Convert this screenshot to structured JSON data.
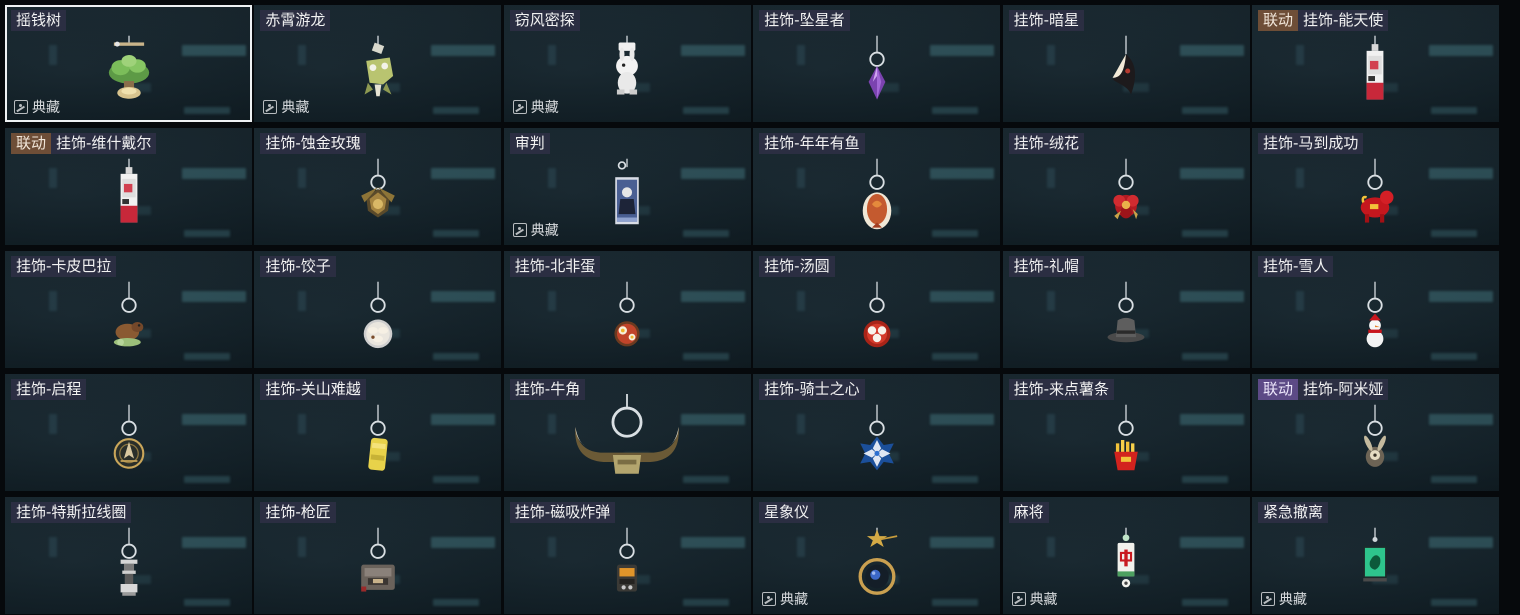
{
  "badges": {
    "linked": "联动",
    "collection": "典藏"
  },
  "items": [
    {
      "name": "摇钱树",
      "linked": false,
      "collection": true,
      "selected": true,
      "art": "money-tree"
    },
    {
      "name": "赤霄游龙",
      "linked": false,
      "collection": true,
      "selected": false,
      "art": "dragon"
    },
    {
      "name": "窃风密探",
      "linked": false,
      "collection": true,
      "selected": false,
      "art": "spy-rabbit"
    },
    {
      "name": "挂饰-坠星者",
      "linked": false,
      "collection": false,
      "selected": false,
      "art": "purple-crystal"
    },
    {
      "name": "挂饰-暗星",
      "linked": false,
      "collection": false,
      "selected": false,
      "art": "dark-star"
    },
    {
      "name": "挂饰-能天使",
      "linked": true,
      "linkTone": "brown",
      "collection": false,
      "selected": false,
      "art": "red-card"
    },
    {
      "name": "挂饰-维什戴尔",
      "linked": true,
      "linkTone": "brown",
      "collection": false,
      "selected": false,
      "art": "red-card"
    },
    {
      "name": "挂饰-蚀金玫瑰",
      "linked": false,
      "collection": false,
      "selected": false,
      "art": "gold-rose"
    },
    {
      "name": "审判",
      "linked": false,
      "collection": true,
      "selected": false,
      "art": "judgment-card"
    },
    {
      "name": "挂饰-年年有鱼",
      "linked": false,
      "collection": false,
      "selected": false,
      "art": "fish"
    },
    {
      "name": "挂饰-绒花",
      "linked": false,
      "collection": false,
      "selected": false,
      "art": "red-flower"
    },
    {
      "name": "挂饰-马到成功",
      "linked": false,
      "collection": false,
      "selected": false,
      "art": "red-horse"
    },
    {
      "name": "挂饰-卡皮巴拉",
      "linked": false,
      "collection": false,
      "selected": false,
      "art": "capybara"
    },
    {
      "name": "挂饰-饺子",
      "linked": false,
      "collection": false,
      "selected": false,
      "art": "dumplings"
    },
    {
      "name": "挂饰-北非蛋",
      "linked": false,
      "collection": false,
      "selected": false,
      "art": "shakshuka"
    },
    {
      "name": "挂饰-汤圆",
      "linked": false,
      "collection": false,
      "selected": false,
      "art": "tangyuan"
    },
    {
      "name": "挂饰-礼帽",
      "linked": false,
      "collection": false,
      "selected": false,
      "art": "top-hat"
    },
    {
      "name": "挂饰-雪人",
      "linked": false,
      "collection": false,
      "selected": false,
      "art": "snowman"
    },
    {
      "name": "挂饰-启程",
      "linked": false,
      "collection": false,
      "selected": false,
      "art": "compass-medal"
    },
    {
      "name": "挂饰-关山难越",
      "linked": false,
      "collection": false,
      "selected": false,
      "art": "yellow-block"
    },
    {
      "name": "挂饰-牛角",
      "linked": false,
      "collection": false,
      "selected": false,
      "art": "bull-horns"
    },
    {
      "name": "挂饰-骑士之心",
      "linked": false,
      "collection": false,
      "selected": false,
      "art": "blue-cross"
    },
    {
      "name": "挂饰-来点薯条",
      "linked": false,
      "collection": false,
      "selected": false,
      "art": "fries"
    },
    {
      "name": "挂饰-阿米娅",
      "linked": true,
      "linkTone": "violet",
      "collection": false,
      "selected": false,
      "art": "rabbit-charm"
    },
    {
      "name": "挂饰-特斯拉线圈",
      "linked": false,
      "collection": false,
      "selected": false,
      "art": "tesla-coil"
    },
    {
      "name": "挂饰-枪匠",
      "linked": false,
      "collection": false,
      "selected": false,
      "art": "gun-case"
    },
    {
      "name": "挂饰-磁吸炸弹",
      "linked": false,
      "collection": false,
      "selected": false,
      "art": "bomb"
    },
    {
      "name": "星象仪",
      "linked": false,
      "collection": true,
      "selected": false,
      "art": "astrolabe"
    },
    {
      "name": "麻将",
      "linked": false,
      "collection": true,
      "selected": false,
      "art": "mahjong"
    },
    {
      "name": "紧急撤离",
      "linked": false,
      "collection": true,
      "selected": false,
      "art": "green-tag"
    }
  ]
}
